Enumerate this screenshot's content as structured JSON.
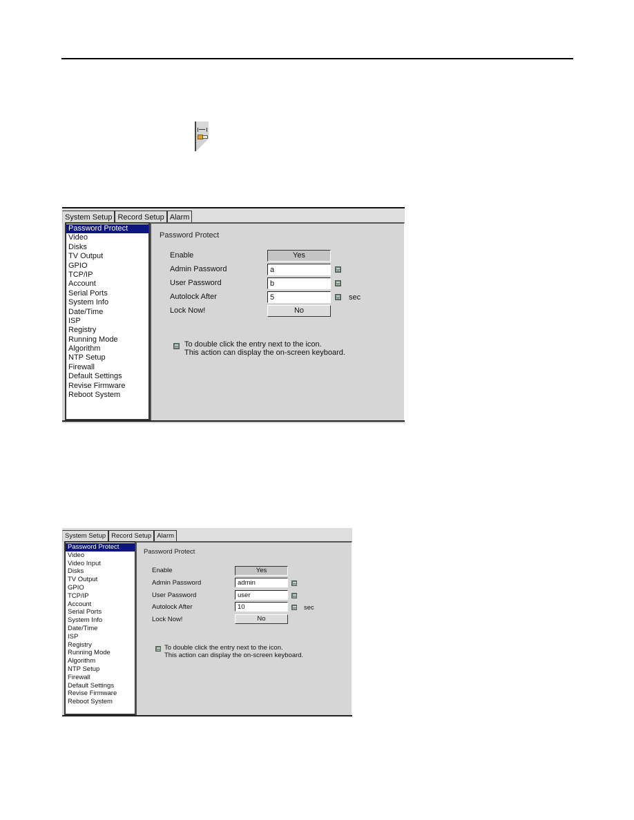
{
  "page": {
    "app_icon": "system-setup-icon"
  },
  "screenshots": [
    {
      "tabs": [
        {
          "label": "System Setup",
          "active": true
        },
        {
          "label": "Record Setup",
          "active": false
        },
        {
          "label": "Alarm",
          "active": false
        }
      ],
      "sidebar": {
        "selected": "Password Protect",
        "items": [
          "Password Protect",
          "Video",
          "Disks",
          "TV Output",
          "GPIO",
          "TCP/IP",
          "Account",
          "Serial Ports",
          "System Info",
          "Date/Time",
          "ISP",
          "Registry",
          "Running Mode",
          "Algorithm",
          "NTP Setup",
          "Firewall",
          "Default Settings",
          "Revise Firmware",
          "Reboot System"
        ]
      },
      "panel": {
        "title": "Password Protect",
        "enable_label": "Enable",
        "enable_value": "Yes",
        "admin_password_label": "Admin Password",
        "admin_password_value": "a",
        "user_password_label": "User Password",
        "user_password_value": "b",
        "autolock_label": "Autolock After",
        "autolock_value": "5",
        "autolock_unit": "sec",
        "lock_now_label": "Lock Now!",
        "lock_now_value": "No",
        "keyboard_icon": "keyboard-icon",
        "note_line1": "To double click the entry next to the icon.",
        "note_line2": "This action can display the on-screen keyboard."
      }
    },
    {
      "tabs": [
        {
          "label": "System Setup",
          "active": true
        },
        {
          "label": "Record Setup",
          "active": false
        },
        {
          "label": "Alarm",
          "active": false
        }
      ],
      "sidebar": {
        "selected": "Password Protect",
        "items": [
          "Password Protect",
          "Video",
          "Video Input",
          "Disks",
          "TV Output",
          "GPIO",
          "TCP/IP",
          "Account",
          "Serial Ports",
          "System Info",
          "Date/Time",
          "ISP",
          "Registry",
          "Running Mode",
          "Algorithm",
          "NTP Setup",
          "Firewall",
          "Default Settings",
          "Revise Firmware",
          "Reboot System"
        ]
      },
      "panel": {
        "title": "Password Protect",
        "enable_label": "Enable",
        "enable_value": "Yes",
        "admin_password_label": "Admin Password",
        "admin_password_value": "admin",
        "user_password_label": "User Password",
        "user_password_value": "user",
        "autolock_label": "Autolock After",
        "autolock_value": "10",
        "autolock_unit": "sec",
        "lock_now_label": "Lock Now!",
        "lock_now_value": "No",
        "keyboard_icon": "keyboard-icon",
        "note_line1": "To double click the entry next to the icon.",
        "note_line2": "This action can display the on-screen keyboard."
      }
    }
  ]
}
